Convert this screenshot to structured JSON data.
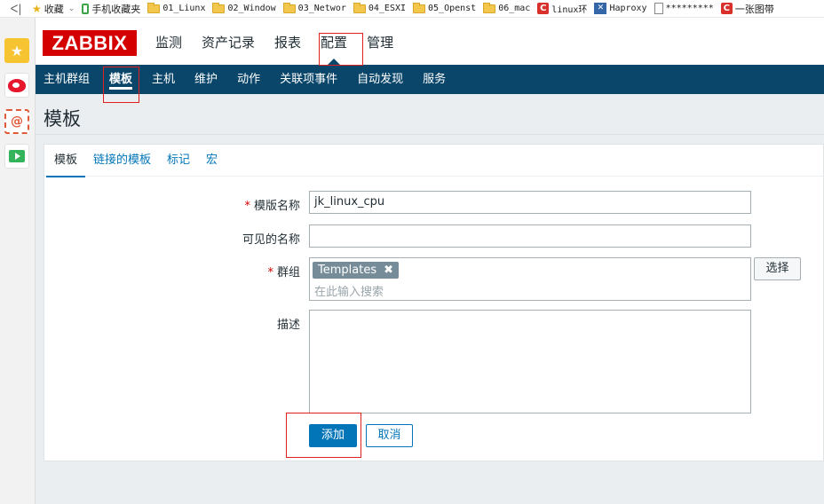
{
  "browser": {
    "back_glyph": "ᐸ|",
    "bookmarks": [
      {
        "label": "收藏",
        "icon": "star-icon"
      },
      {
        "label": "手机收藏夹",
        "icon": "phone-icon"
      },
      {
        "label": "01_Liunx",
        "icon": "folder-icon"
      },
      {
        "label": "02_Window",
        "icon": "folder-icon"
      },
      {
        "label": "03_Networ",
        "icon": "folder-icon"
      },
      {
        "label": "04_ESXI",
        "icon": "folder-icon"
      },
      {
        "label": "05_Openst",
        "icon": "folder-icon"
      },
      {
        "label": "06_mac",
        "icon": "folder-icon"
      },
      {
        "label": "linux环",
        "icon": "c-logo-icon"
      },
      {
        "label": "Haproxy",
        "icon": "haproxy-icon"
      },
      {
        "label": "*********",
        "icon": "document-icon"
      },
      {
        "label": "一张图带",
        "icon": "c-logo-icon"
      }
    ]
  },
  "sidebar": {
    "items": [
      {
        "name": "favorites",
        "glyph": "★"
      },
      {
        "name": "weibo",
        "glyph": ""
      },
      {
        "name": "mail",
        "glyph": "@"
      },
      {
        "name": "video",
        "glyph": ""
      }
    ]
  },
  "header": {
    "logo": "ZABBIX",
    "menu": [
      "监测",
      "资产记录",
      "报表",
      "配置",
      "管理"
    ],
    "selected_menu": "配置"
  },
  "subnav": {
    "items": [
      "主机群组",
      "模板",
      "主机",
      "维护",
      "动作",
      "关联项事件",
      "自动发现",
      "服务"
    ],
    "selected": "模板"
  },
  "page": {
    "title": "模板",
    "tabs": [
      "模板",
      "链接的模板",
      "标记",
      "宏"
    ],
    "active_tab": "模板"
  },
  "form": {
    "template_name_label": "模版名称",
    "template_name_value": "jk_linux_cpu",
    "visible_name_label": "可见的名称",
    "visible_name_value": "",
    "groups_label": "群组",
    "group_chip": "Templates",
    "group_chip_remove": "✖",
    "groups_placeholder": "在此输入搜索",
    "select_button": "选择",
    "description_label": "描述",
    "description_value": "",
    "required_mark": "*",
    "add_button": "添加",
    "cancel_button": "取消"
  },
  "colors": {
    "brand_red": "#d40000",
    "nav_blue": "#0a466a",
    "link_blue": "#0275b8",
    "highlight_red": "#e02020"
  }
}
